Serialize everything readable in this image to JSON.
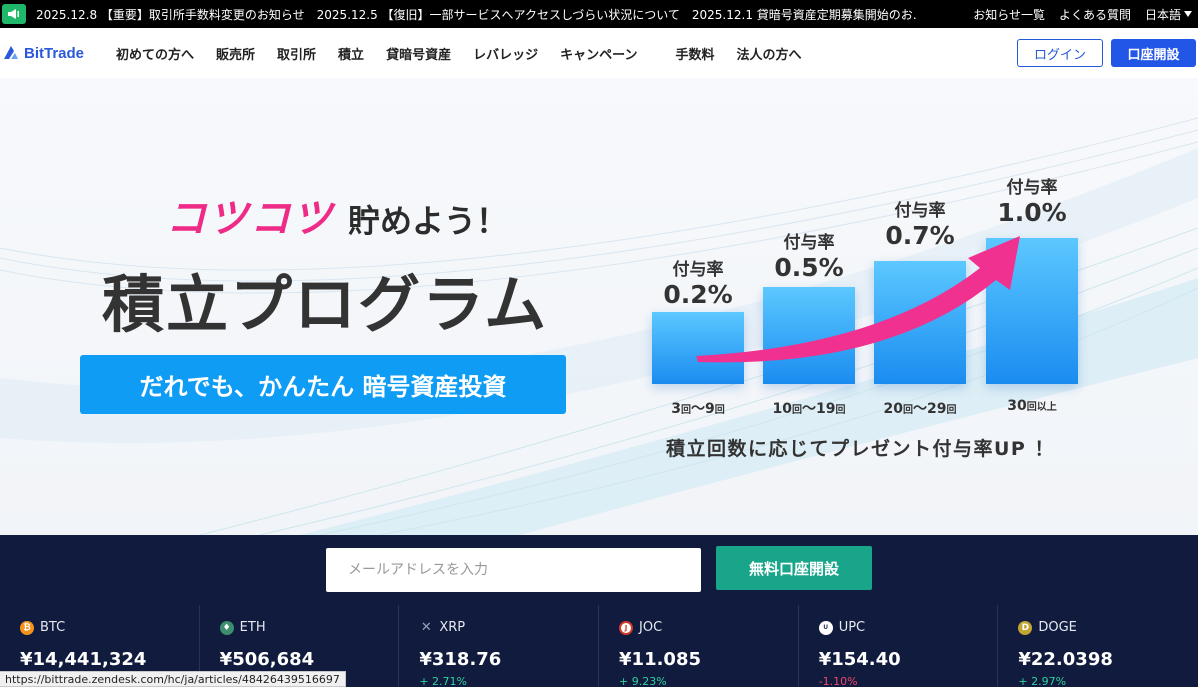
{
  "notices": {
    "items": [
      "2025.12.8 【重要】取引所手数料変更のお知らせ",
      "2025.12.5 【復旧】一部サービスへアクセスしづらい状況について",
      "2025.12.1 貸暗号資産定期募集開始のお…"
    ],
    "links": [
      "お知らせ一覧",
      "よくある質問"
    ],
    "language": "日本語"
  },
  "header": {
    "logo": "BitTrade",
    "nav": [
      "初めての方へ",
      "販売所",
      "取引所",
      "積立",
      "貸暗号資産",
      "レバレッジ",
      "キャンペーン",
      "手数料",
      "法人の方へ"
    ],
    "login_label": "ログイン",
    "open_account_label": "口座開設"
  },
  "hero": {
    "tagline_pink": "コツコツ",
    "tagline_rest": "貯めよう！",
    "title": "積立プログラム",
    "banner": "だれでも、かんたん 暗号資産投資",
    "rates": [
      {
        "label": "付与率",
        "value": "0.2%",
        "tier_a": "3",
        "tier_unit1": "回",
        "tier_sep": "～",
        "tier_b": "9",
        "tier_unit2": "回"
      },
      {
        "label": "付与率",
        "value": "0.5%",
        "tier_a": "10",
        "tier_unit1": "回",
        "tier_sep": "～",
        "tier_b": "19",
        "tier_unit2": "回"
      },
      {
        "label": "付与率",
        "value": "0.7%",
        "tier_a": "20",
        "tier_unit1": "回",
        "tier_sep": "～",
        "tier_b": "29",
        "tier_unit2": "回"
      },
      {
        "label": "付与率",
        "value": "1.0%",
        "tier_a": "30",
        "tier_unit1": "回以上",
        "tier_sep": "",
        "tier_b": "",
        "tier_unit2": ""
      }
    ],
    "note": "積立回数に応じてプレゼント付与率UP ！"
  },
  "signup": {
    "email_placeholder": "メールアドレスを入力",
    "button": "無料口座開設"
  },
  "tickers": [
    {
      "symbol": "BTC",
      "price": "¥14,441,324",
      "change": "",
      "direction": "none",
      "color": "#f7931a",
      "icon": "bitcoin-icon"
    },
    {
      "symbol": "ETH",
      "price": "¥506,684",
      "change": "",
      "direction": "none",
      "color": "#3c8e6e",
      "icon": "ethereum-icon"
    },
    {
      "symbol": "XRP",
      "price": "¥318.76",
      "change": "+ 2.71%",
      "direction": "up",
      "color": "#8a8fa6",
      "icon": "xrp-icon"
    },
    {
      "symbol": "JOC",
      "price": "¥11.085",
      "change": "+ 9.23%",
      "direction": "up",
      "color": "#d23a2a",
      "icon": "joc-icon"
    },
    {
      "symbol": "UPC",
      "price": "¥154.40",
      "change": "-1.10%",
      "direction": "down",
      "color": "#2d3a66",
      "icon": "upc-icon"
    },
    {
      "symbol": "DOGE",
      "price": "¥22.0398",
      "change": "+ 2.97%",
      "direction": "up",
      "color": "#c2a633",
      "icon": "doge-icon"
    }
  ],
  "status_url": "https://bittrade.zendesk.com/hc/ja/articles/48426439516697"
}
